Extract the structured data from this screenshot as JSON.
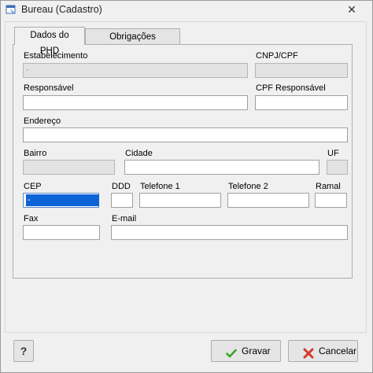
{
  "window": {
    "title": "Bureau (Cadastro)",
    "close_glyph": "✕"
  },
  "tabs": [
    {
      "label": "Dados do PHD",
      "active": true
    },
    {
      "label": "Obrigações Acessórias",
      "active": false
    }
  ],
  "form": {
    "estabelecimento": {
      "label": "Estabelecimento",
      "value": "·"
    },
    "cnpj": {
      "label": "CNPJ/CPF",
      "value": ""
    },
    "responsavel": {
      "label": "Responsável",
      "value": ""
    },
    "cpf_responsavel": {
      "label": "CPF Responsável",
      "value": ""
    },
    "endereco": {
      "label": "Endereço",
      "value": ""
    },
    "bairro": {
      "label": "Bairro",
      "value": ""
    },
    "cidade": {
      "label": "Cidade",
      "value": ""
    },
    "uf": {
      "label": "UF",
      "value": ""
    },
    "cep": {
      "label": "CEP",
      "value": "     -   "
    },
    "ddd": {
      "label": "DDD",
      "value": ""
    },
    "telefone1": {
      "label": "Telefone 1",
      "value": ""
    },
    "telefone2": {
      "label": "Telefone 2",
      "value": ""
    },
    "ramal": {
      "label": "Ramal",
      "value": ""
    },
    "fax": {
      "label": "Fax",
      "value": ""
    },
    "email": {
      "label": "E-mail",
      "value": ""
    }
  },
  "buttons": {
    "help": "?",
    "save": "Gravar",
    "cancel": "Cancelar"
  },
  "colors": {
    "save_icon": "#3aa52b",
    "cancel_icon": "#d23a2a",
    "selection": "#0a64d6"
  },
  "icons": {
    "app": "app-window-icon",
    "save": "check-icon",
    "cancel": "x-icon"
  }
}
